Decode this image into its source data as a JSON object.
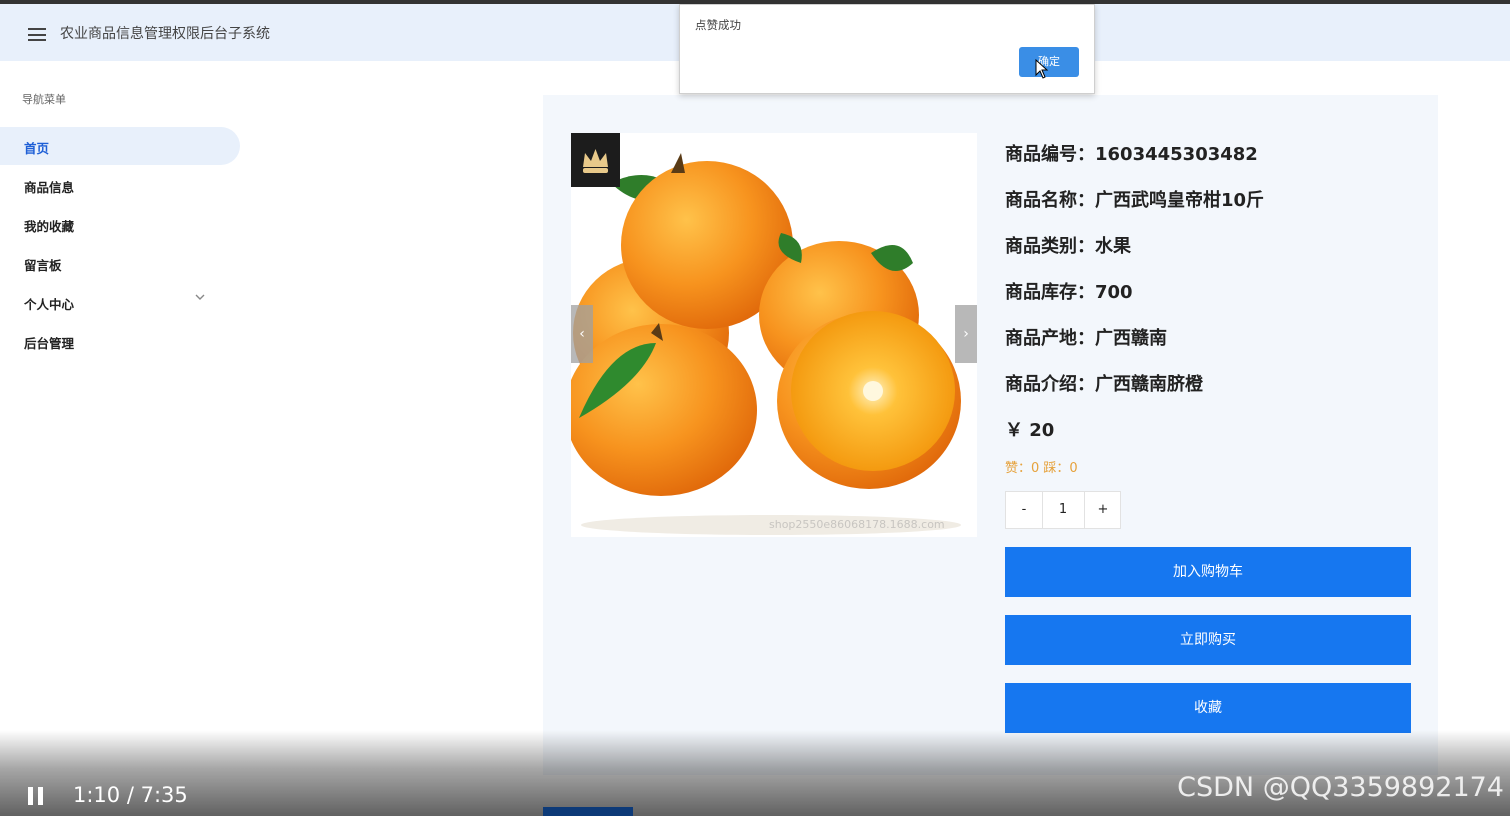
{
  "header": {
    "title": "农业商品信息管理权限后台子系统",
    "menu_icon": "hamburger-icon"
  },
  "sidebar": {
    "caption": "导航菜单",
    "items": [
      {
        "label": "首页",
        "active": true
      },
      {
        "label": "商品信息"
      },
      {
        "label": "我的收藏"
      },
      {
        "label": "留言板"
      },
      {
        "label": "个人中心",
        "expandable": true
      },
      {
        "label": "后台管理"
      }
    ]
  },
  "product": {
    "fields": [
      "商品编号：1603445303482",
      "商品名称：广西武鸣皇帝柑10斤",
      "商品类别：水果",
      "商品库存：700",
      "商品产地：广西赣南",
      "商品介绍：广西赣南脐橙"
    ],
    "price": "￥ 20",
    "votes": "赞：0 踩：0",
    "quantity": {
      "minus": "-",
      "value": "1",
      "plus": "+"
    },
    "buttons": {
      "add_cart": "加入购物车",
      "buy_now": "立即购买",
      "favorite": "收藏"
    },
    "image_watermark": "shop2550e86068178.1688.com",
    "carousel_prev": "‹",
    "carousel_next": "›"
  },
  "dialog": {
    "message": "点赞成功",
    "ok": "确定"
  },
  "video": {
    "time": "1:10 / 7:35",
    "watermark": "CSDN @QQ3359892174"
  },
  "colors": {
    "accent": "#1677f0",
    "header_bg": "#e8f0fb",
    "vote": "#e6a23c"
  }
}
